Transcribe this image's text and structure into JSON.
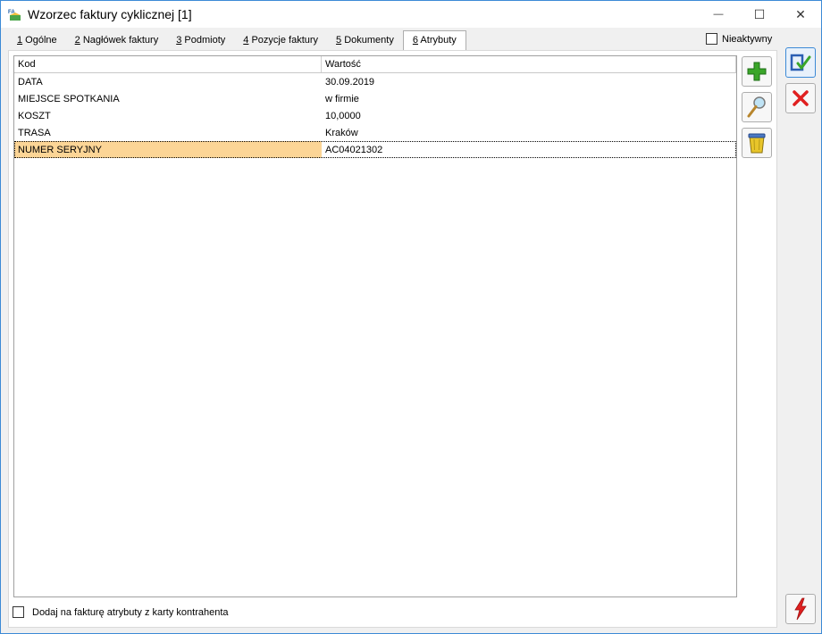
{
  "window": {
    "title": "Wzorzec faktury cyklicznej [1]",
    "app_icon_label": "FA",
    "minimize": "—",
    "maximize": "☐",
    "close": "✕"
  },
  "tabs": [
    {
      "num": "1",
      "label": " Ogólne"
    },
    {
      "num": "2",
      "label": " Nagłówek faktury"
    },
    {
      "num": "3",
      "label": " Podmioty"
    },
    {
      "num": "4",
      "label": " Pozycje faktury"
    },
    {
      "num": "5",
      "label": " Dokumenty"
    },
    {
      "num": "6",
      "label": " Atrybuty"
    }
  ],
  "active_tab": 5,
  "inactive_label": "Nieaktywny",
  "grid": {
    "headers": {
      "kod": "Kod",
      "wartosc": "Wartość"
    },
    "rows": [
      {
        "kod": "DATA",
        "wartosc": "30.09.2019"
      },
      {
        "kod": "MIEJSCE SPOTKANIA",
        "wartosc": "w firmie"
      },
      {
        "kod": "KOSZT",
        "wartosc": "10,0000"
      },
      {
        "kod": "TRASA",
        "wartosc": "Kraków"
      },
      {
        "kod": "NUMER SERYJNY",
        "wartosc": "AC04021302"
      }
    ],
    "selected_row": 4
  },
  "bottom_checkbox_label": "Dodaj na fakturę atrybuty z karty kontrahenta",
  "colors": {
    "selection": "#fcd596",
    "window_border": "#3c8ad6",
    "add_green": "#3aa629",
    "cancel_red": "#e02020"
  },
  "icons": {
    "add": "plus-icon",
    "edit": "magnifier-icon",
    "delete": "trash-icon",
    "save": "save-icon",
    "cancel": "cancel-icon",
    "lightning": "lightning-icon"
  }
}
